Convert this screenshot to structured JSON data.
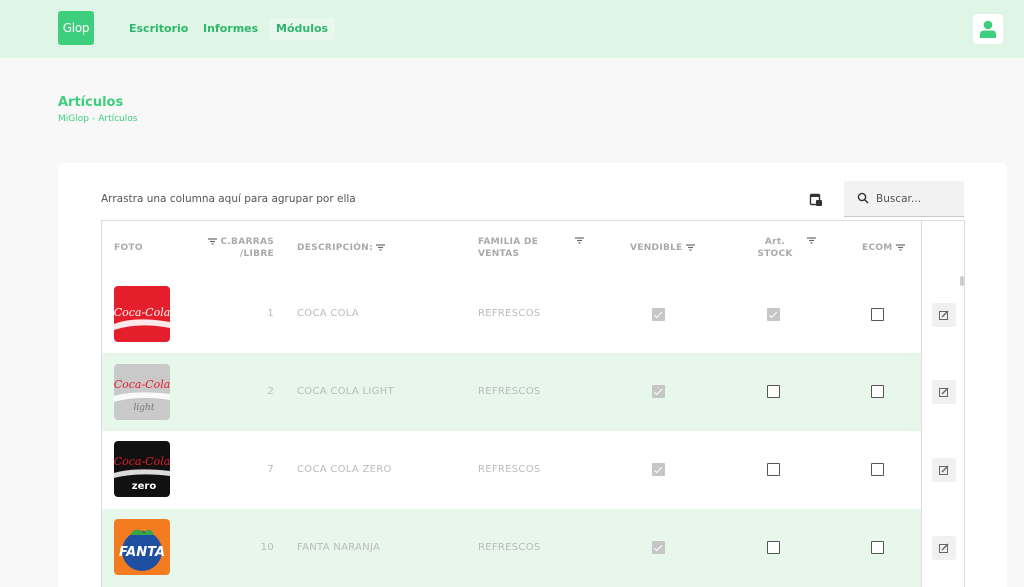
{
  "nav": {
    "logo_text": "Glop",
    "items": [
      {
        "label": "Escritorio"
      },
      {
        "label": "Informes"
      },
      {
        "label": "Módulos"
      }
    ],
    "user_icon": "user-icon"
  },
  "header": {
    "title": "Artículos",
    "breadcrumb": [
      "MiGlop",
      "Artículos"
    ],
    "breadcrumb_sep": "-"
  },
  "toolbar": {
    "group_hint": "Arrastra una columna aquí para agrupar por ella",
    "export_icon": "excel-export-icon",
    "search_placeholder": "Buscar..."
  },
  "table": {
    "columns": [
      {
        "line1": "FOTO",
        "line2": ""
      },
      {
        "line1": "C.BARRAS",
        "line2": "/LIBRE"
      },
      {
        "line1": "DESCRIPCIÓN:",
        "line2": ""
      },
      {
        "line1": "FAMILIA DE",
        "line2": "VENTAS"
      },
      {
        "line1": "VENDIBLE",
        "line2": ""
      },
      {
        "line1": "Art.",
        "line2": "STOCK"
      },
      {
        "line1": "ECOM",
        "line2": ""
      }
    ],
    "rows": [
      {
        "image": "coca-cola-logo",
        "logo_line1": "Coca-Cola",
        "logo_line2": "",
        "barcode": "1",
        "description": "COCA COLA",
        "family": "REFRESCOS",
        "vendible": true,
        "stock": true,
        "ecom": false
      },
      {
        "image": "coca-cola-light-logo",
        "logo_line1": "Coca-Cola",
        "logo_line2": "light",
        "barcode": "2",
        "description": "COCA COLA LIGHT",
        "family": "REFRESCOS",
        "vendible": true,
        "stock": false,
        "ecom": false
      },
      {
        "image": "coca-cola-zero-logo",
        "logo_line1": "Coca-Cola",
        "logo_line2": "zero",
        "barcode": "7",
        "description": "COCA COLA ZERO",
        "family": "REFRESCOS",
        "vendible": true,
        "stock": false,
        "ecom": false
      },
      {
        "image": "fanta-logo",
        "logo_line1": "FANTA",
        "logo_line2": "",
        "barcode": "10",
        "description": "FANTA NARANJA",
        "family": "REFRESCOS",
        "vendible": true,
        "stock": false,
        "ecom": false
      }
    ]
  },
  "colors": {
    "accent": "#3dcf7d",
    "topbar": "#dff5e6",
    "row_alt": "#e7f7ec"
  }
}
